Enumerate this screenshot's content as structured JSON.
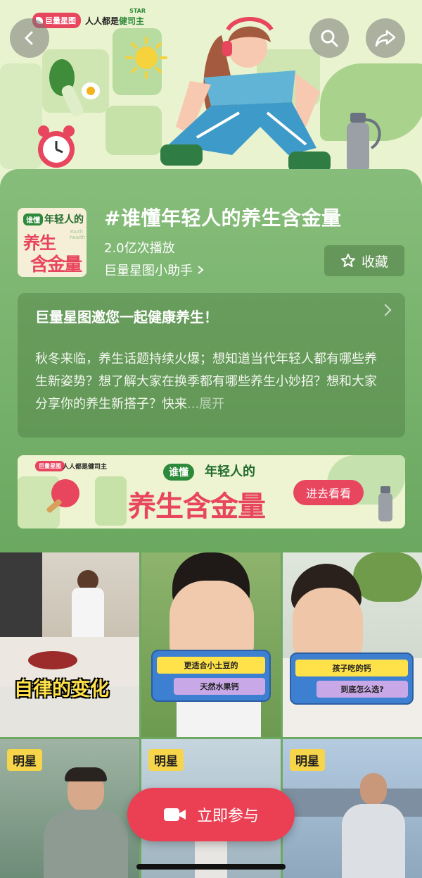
{
  "brand": {
    "chip": "巨量星图",
    "slogan_a": "人人都是",
    "slogan_b": "健司主",
    "star": "STAR"
  },
  "topic": {
    "title": "#谁懂年轻人的养生含金量",
    "plays": "2.0亿次播放",
    "author": "巨量星图小助手",
    "favorite_label": "收藏"
  },
  "cover": {
    "tag": "谁懂",
    "young": "年轻人的",
    "line1": "养生",
    "line2": "含金量",
    "youth": "Youth health"
  },
  "description": {
    "title": "巨量星图邀您一起健康养生！",
    "body": "秋冬来临，养生话题持续火爆；想知道当代年轻人都有哪些养生新姿势？想了解大家在换季都有哪些养生小妙招？想和大家分享你的养生新搭子？快来",
    "more": "...展开"
  },
  "banner": {
    "chip": "巨量星图",
    "slogan": "人人都是健司主",
    "tag": "谁懂",
    "young": "年轻人的",
    "big": "养生含金量",
    "button": "进去看看"
  },
  "videos": [
    {
      "caption": "自律的变化"
    },
    {
      "board_line1": "更适合小土豆的",
      "board_line2": "天然水果钙"
    },
    {
      "board_line1": "孩子吃的钙",
      "board_line2": "到底怎么选?"
    },
    {
      "tag": "明星"
    },
    {
      "tag": "明星"
    },
    {
      "tag": "明星"
    }
  ],
  "join_label": "立即参与",
  "colors": {
    "accent": "#eb4054",
    "panel": "#78b26b",
    "tag": "#f7d54a"
  }
}
